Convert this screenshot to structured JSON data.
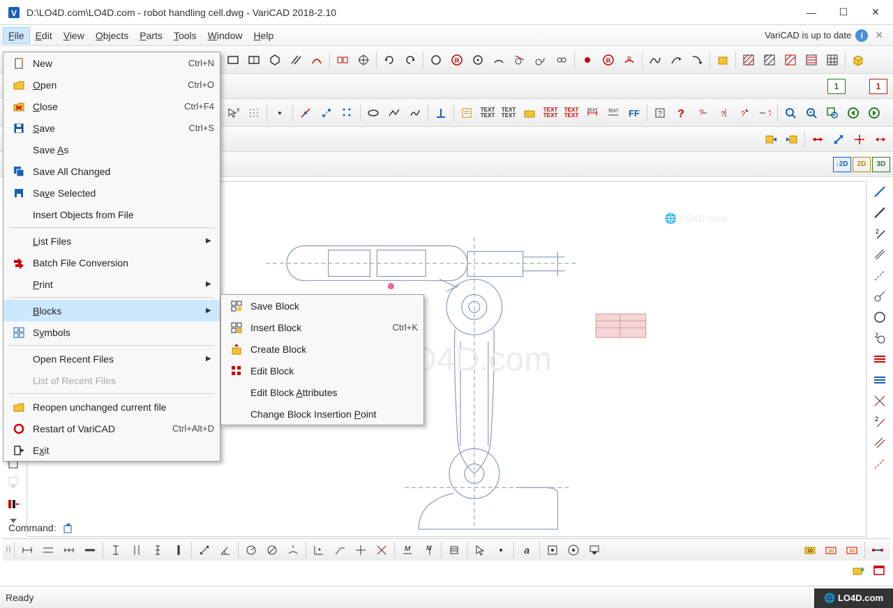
{
  "title": "D:\\LO4D.com\\LO4D.com - robot handling cell.dwg - VariCAD 2018-2.10",
  "menubar": {
    "items": [
      "File",
      "Edit",
      "View",
      "Objects",
      "Parts",
      "Tools",
      "Window",
      "Help"
    ],
    "update_text": "VariCAD is up to date"
  },
  "file_menu": {
    "items": [
      {
        "label": "New",
        "shortcut": "Ctrl+N",
        "icon": "new-icon"
      },
      {
        "label": "Open",
        "shortcut": "Ctrl+O",
        "icon": "open-icon"
      },
      {
        "label": "Close",
        "shortcut": "Ctrl+F4",
        "icon": "close-file-icon"
      },
      {
        "label": "Save",
        "shortcut": "Ctrl+S",
        "icon": "save-icon"
      },
      {
        "label": "Save As",
        "shortcut": "",
        "icon": ""
      },
      {
        "label": "Save All Changed",
        "shortcut": "",
        "icon": "save-all-icon"
      },
      {
        "label": "Save Selected",
        "shortcut": "",
        "icon": "save-sel-icon"
      },
      {
        "label": "Insert Objects from File",
        "shortcut": "",
        "icon": ""
      },
      {
        "sep": true
      },
      {
        "label": "List Files",
        "shortcut": "",
        "icon": "",
        "submenu": true
      },
      {
        "label": "Batch File Conversion",
        "shortcut": "",
        "icon": "batch-icon"
      },
      {
        "label": "Print",
        "shortcut": "",
        "icon": "",
        "submenu": true
      },
      {
        "sep": true
      },
      {
        "label": "Blocks",
        "shortcut": "",
        "icon": "",
        "submenu": true,
        "highlighted": true
      },
      {
        "label": "Symbols",
        "shortcut": "",
        "icon": "symbols-icon"
      },
      {
        "sep": true
      },
      {
        "label": "Open Recent Files",
        "shortcut": "",
        "icon": "",
        "submenu": true
      },
      {
        "label": "List of Recent Files",
        "shortcut": "",
        "icon": "",
        "disabled": true
      },
      {
        "sep": true
      },
      {
        "label": "Reopen unchanged current file",
        "shortcut": "",
        "icon": "reopen-icon"
      },
      {
        "label": "Restart of VariCAD",
        "shortcut": "Ctrl+Alt+D",
        "icon": "restart-icon"
      },
      {
        "label": "Exit",
        "shortcut": "",
        "icon": "exit-icon"
      }
    ]
  },
  "blocks_submenu": {
    "items": [
      {
        "label": "Save Block",
        "shortcut": "",
        "icon": "save-block-icon"
      },
      {
        "label": "Insert Block",
        "shortcut": "Ctrl+K",
        "icon": "insert-block-icon"
      },
      {
        "label": "Create Block",
        "shortcut": "",
        "icon": "create-block-icon"
      },
      {
        "label": "Edit Block",
        "shortcut": "",
        "icon": "edit-block-icon"
      },
      {
        "label": "Edit Block Attributes",
        "shortcut": "",
        "icon": ""
      },
      {
        "label": "Change Block Insertion Point",
        "shortcut": "",
        "icon": ""
      }
    ]
  },
  "badges": {
    "one": "1",
    "one2": "1"
  },
  "mode": {
    "d2": "2D",
    "d2b": "2D",
    "d3": "3D"
  },
  "command": {
    "label": "Command:"
  },
  "status": {
    "text": "Ready"
  },
  "watermark": "LO4D.com"
}
